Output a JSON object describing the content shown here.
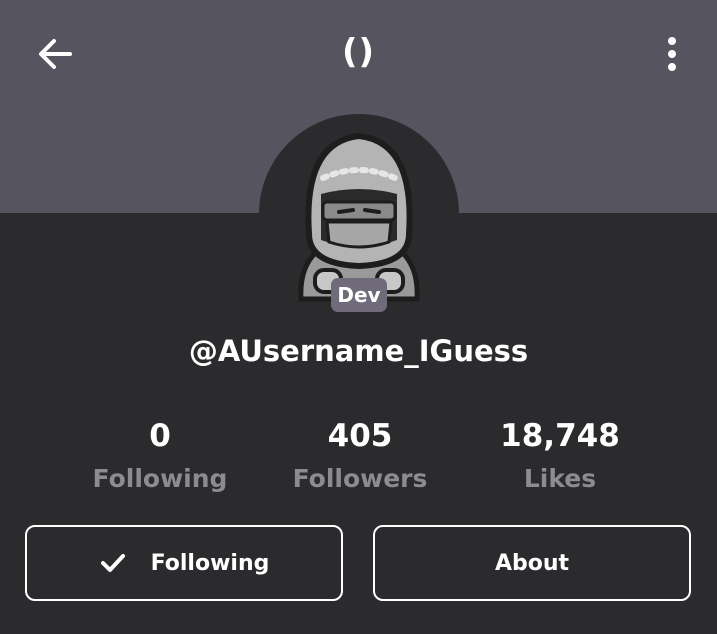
{
  "header": {
    "title": "()",
    "back_icon": "arrow-left-icon",
    "menu_icon": "more-vertical-icon"
  },
  "profile": {
    "badge": "Dev",
    "username": "@AUsername_IGuess"
  },
  "stats": [
    {
      "value": "0",
      "label": "Following"
    },
    {
      "value": "405",
      "label": "Followers"
    },
    {
      "value": "18,748",
      "label": "Likes"
    }
  ],
  "actions": {
    "following_label": "Following",
    "following_icon": "check-icon",
    "about_label": "About"
  },
  "colors": {
    "header_bg": "#55545f",
    "page_bg": "#2b2a2d",
    "muted_text": "#8c8b90",
    "badge_bg": "#6f6b7a"
  }
}
